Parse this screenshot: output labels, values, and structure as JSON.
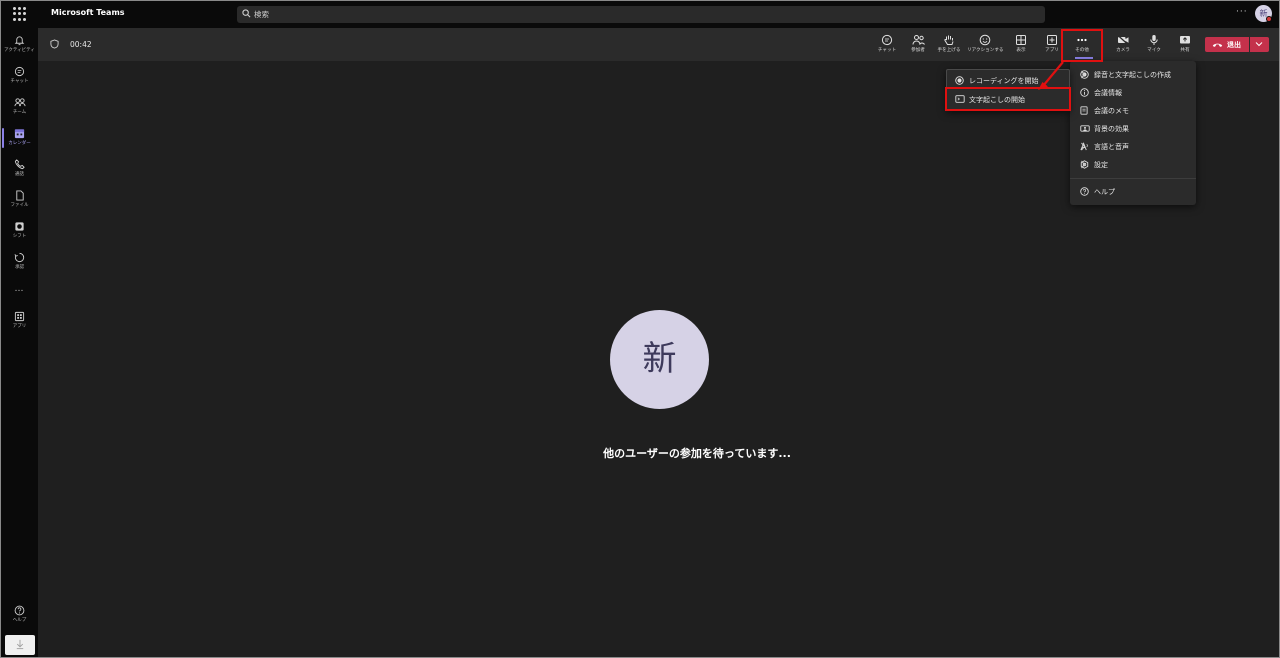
{
  "app": {
    "title": "Microsoft Teams"
  },
  "search": {
    "placeholder": "検索"
  },
  "user": {
    "avatar_initial": "新"
  },
  "rail": {
    "items": [
      {
        "label": "アクティビティ",
        "icon": "bell-icon"
      },
      {
        "label": "チャット",
        "icon": "chat-icon"
      },
      {
        "label": "チーム",
        "icon": "teams-icon"
      },
      {
        "label": "カレンダー",
        "icon": "calendar-icon"
      },
      {
        "label": "通話",
        "icon": "phone-icon"
      },
      {
        "label": "ファイル",
        "icon": "file-icon"
      },
      {
        "label": "シフト",
        "icon": "shifts-icon"
      },
      {
        "label": "承認",
        "icon": "approvals-icon"
      },
      {
        "label": "アプリ",
        "icon": "apps-icon"
      },
      {
        "label": "ヘルプ",
        "icon": "help-icon"
      }
    ],
    "more": "…"
  },
  "meeting": {
    "timer": "00:42",
    "toolbar": {
      "chat": "チャット",
      "participants": "参加者",
      "raise_hand": "手を上げる",
      "reactions": "リアクションする",
      "view": "表示",
      "apps": "アプリ",
      "more": "その他",
      "camera": "カメラ",
      "mic": "マイク",
      "share": "共有",
      "leave": "退出"
    },
    "waiting_message": "他のユーザーの参加を待っています..."
  },
  "more_menu": {
    "items": [
      {
        "label": "録音と文字起こしの作成",
        "icon": "record-icon",
        "has_submenu": true
      },
      {
        "label": "会議情報",
        "icon": "info-icon",
        "has_submenu": false
      },
      {
        "label": "会議のメモ",
        "icon": "notes-icon",
        "has_submenu": false
      },
      {
        "label": "背景の効果",
        "icon": "background-effects-icon",
        "has_submenu": false
      },
      {
        "label": "言語と音声",
        "icon": "language-icon",
        "has_submenu": true
      },
      {
        "label": "設定",
        "icon": "settings-icon",
        "has_submenu": true
      },
      {
        "label": "ヘルプ",
        "icon": "help-icon",
        "has_submenu": false
      }
    ]
  },
  "sub_menu": {
    "items": [
      {
        "label": "レコーディングを開始",
        "icon": "record-icon"
      },
      {
        "label": "文字起こしの開始",
        "icon": "transcript-icon"
      }
    ]
  },
  "colors": {
    "accent": "#8a80e6",
    "leave": "#c4314b",
    "highlight": "#e01010",
    "avatar_bg": "#d6d2e6"
  }
}
